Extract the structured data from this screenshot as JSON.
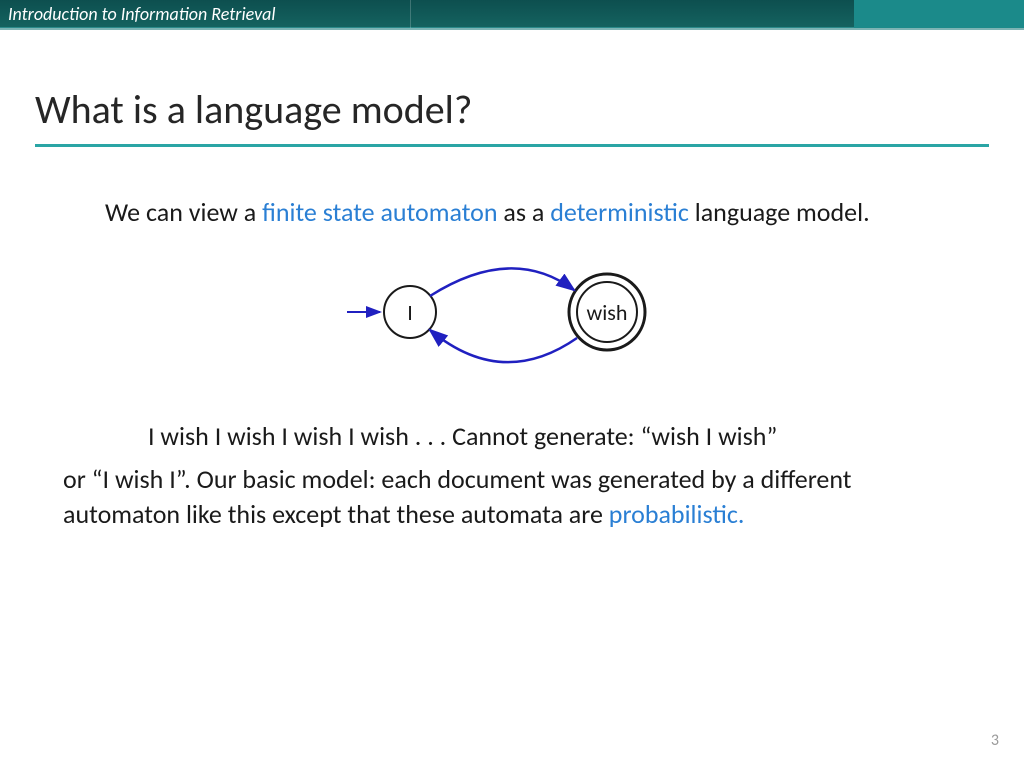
{
  "header": {
    "course_title": "Introduction to Information Retrieval"
  },
  "slide": {
    "title": "What is a language model?",
    "p1_a": "We can view a ",
    "p1_h1": "finite state automaton",
    "p1_b": " as a ",
    "p1_h2": "deterministic",
    "p1_c": " language model.",
    "diagram": {
      "state1": "I",
      "state2": "wish"
    },
    "p2": "I wish I wish I wish I wish . . .  Cannot generate: “wish I wish”",
    "p3_a": "or “I wish I”. Our basic model: each document was generated by a different automaton like this except that these automata are ",
    "p3_h": "probabilistic."
  },
  "page_number": "3"
}
